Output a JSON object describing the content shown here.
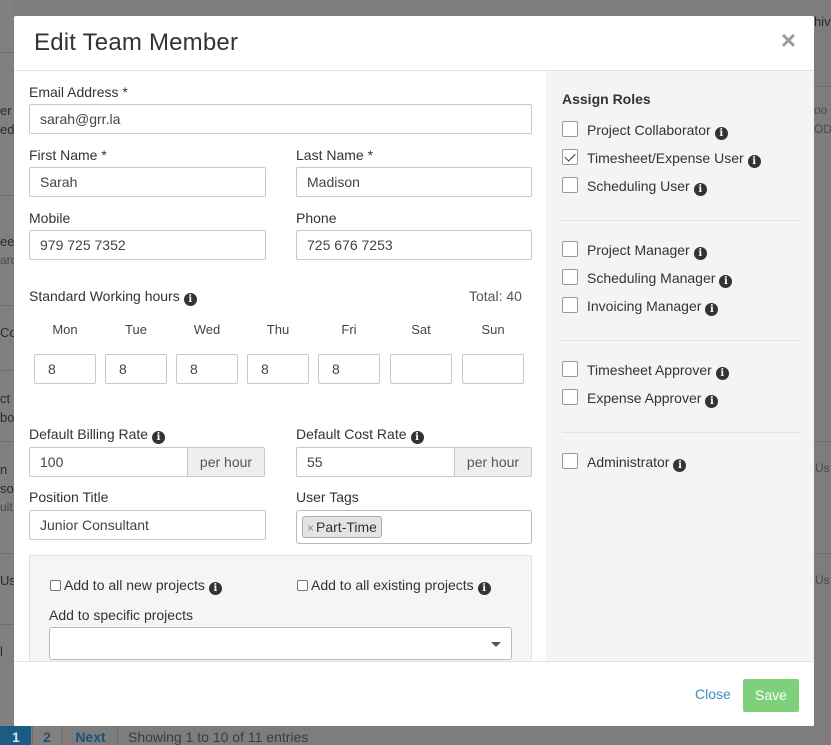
{
  "background": {
    "fragments_right": [
      "hiv",
      "oo",
      "OD",
      "Us",
      "Us"
    ],
    "fragments_left": [
      "er",
      "ed",
      "ee",
      "arc",
      "Col",
      "ct",
      "bo",
      "n",
      "so",
      "ult",
      "Us",
      "l"
    ],
    "pagination": {
      "page1": "1",
      "page2": "2",
      "next": "Next",
      "info": "Showing 1 to 10 of 11 entries"
    }
  },
  "modal": {
    "title": "Edit Team Member",
    "close_glyph": "×"
  },
  "form": {
    "email_label": "Email Address",
    "required_mark": "*",
    "email_value": "sarah@grr.la",
    "first_name_label": "First Name",
    "first_name_value": "Sarah",
    "last_name_label": "Last Name",
    "last_name_value": "Madison",
    "mobile_label": "Mobile",
    "mobile_value": "979 725 7352",
    "phone_label": "Phone",
    "phone_value": "725 676 7253",
    "working_hours_label": "Standard Working hours",
    "total_label": "Total: 40",
    "days": [
      {
        "name": "Mon",
        "value": "8"
      },
      {
        "name": "Tue",
        "value": "8"
      },
      {
        "name": "Wed",
        "value": "8"
      },
      {
        "name": "Thu",
        "value": "8"
      },
      {
        "name": "Fri",
        "value": "8"
      },
      {
        "name": "Sat",
        "value": ""
      },
      {
        "name": "Sun",
        "value": ""
      }
    ],
    "billing_rate_label": "Default Billing Rate",
    "billing_rate_value": "100",
    "cost_rate_label": "Default Cost Rate",
    "cost_rate_value": "55",
    "per_hour": "per hour",
    "position_label": "Position Title",
    "position_value": "Junior Consultant",
    "user_tags_label": "User Tags",
    "tag_remove": "×",
    "tags": [
      "Part-Time"
    ],
    "add_new_projects_label": "Add to all new projects",
    "add_existing_projects_label": "Add to all existing projects",
    "add_specific_label": "Add to specific projects",
    "info_glyph": "i"
  },
  "roles": {
    "title": "Assign Roles",
    "items": [
      {
        "label": "Project Collaborator",
        "checked": false
      },
      {
        "label": "Timesheet/Expense User",
        "checked": true
      },
      {
        "label": "Scheduling User",
        "checked": false
      },
      {
        "label": "Project Manager",
        "checked": false
      },
      {
        "label": "Scheduling Manager",
        "checked": false
      },
      {
        "label": "Invoicing Manager",
        "checked": false
      },
      {
        "label": "Timesheet Approver",
        "checked": false
      },
      {
        "label": "Expense Approver",
        "checked": false
      },
      {
        "label": "Administrator",
        "checked": false
      }
    ]
  },
  "footer": {
    "close_label": "Close",
    "save_label": "Save"
  },
  "colors": {
    "save_button": "#7ed07a",
    "close_link": "#3a8fc0",
    "overlay": "#7d7d7d"
  }
}
